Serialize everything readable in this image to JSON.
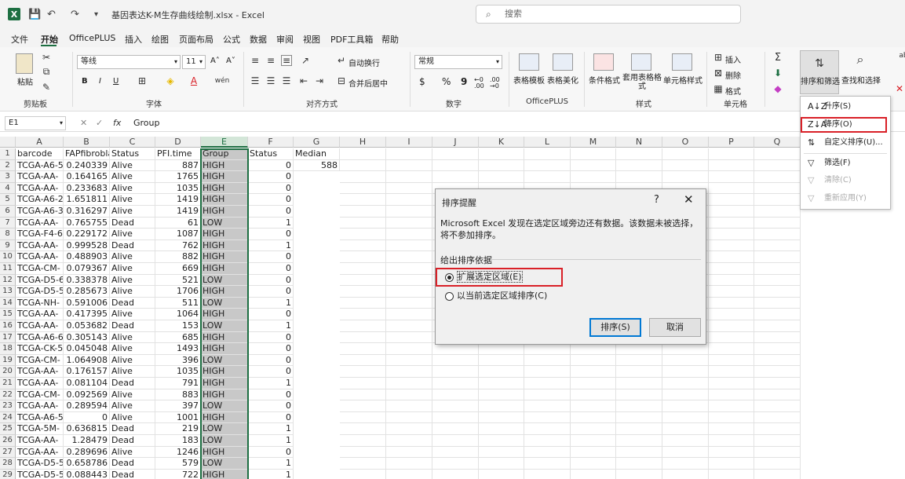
{
  "titlebar": {
    "save_glyph": "💾",
    "undo_glyph": "↶",
    "redo_glyph": "↷",
    "custom_glyph": "▾",
    "title": "基因表达K-M生存曲线绘制.xlsx  -  Excel",
    "search_placeholder": "搜索"
  },
  "menu": [
    "文件",
    "开始",
    "OfficePLUS",
    "插入",
    "绘图",
    "页面布局",
    "公式",
    "数据",
    "审阅",
    "视图",
    "PDF工具箱",
    "帮助"
  ],
  "ribbon": {
    "clipboard": {
      "label": "剪贴板",
      "paste": "粘贴"
    },
    "font": {
      "label": "字体",
      "name": "等线",
      "size": "11",
      "bold": "B",
      "italic": "I",
      "underline": "U",
      "grow": "A˄",
      "shrink": "A˅"
    },
    "align": {
      "label": "对齐方式",
      "wrap": "自动换行",
      "merge": "合并后居中"
    },
    "number": {
      "label": "数字",
      "format": "常规",
      "currency": "$",
      "percent": "%",
      "comma": "9",
      "inc": "←0 .00",
      "dec": ".00 →0"
    },
    "officeplus": {
      "label": "OfficePLUS",
      "table_template": "表格模板",
      "table_beautify": "表格美化"
    },
    "styles": {
      "label": "样式",
      "cond_format": "条件格式",
      "apply_table": "套用表格格式",
      "cell_styles": "单元格样式"
    },
    "cells": {
      "label": "单元格",
      "insert": "插入",
      "delete": "删除",
      "format": "格式"
    },
    "editing": {
      "sum": "Σ",
      "fill": "⬇",
      "clear": "◆",
      "sort_filter": "排序和筛选",
      "find_select": "查找和选择",
      "side1": "ab",
      "side2": "✕"
    }
  },
  "formula": {
    "namebox": "E1",
    "fx": "fx",
    "content": "Group"
  },
  "columns": [
    "A",
    "B",
    "C",
    "D",
    "E",
    "F",
    "G",
    "H",
    "I",
    "J",
    "K",
    "L",
    "M",
    "N",
    "O",
    "P",
    "Q"
  ],
  "headers": {
    "a": "barcode",
    "b": "FAPfibroblasts",
    "c": "Status",
    "d": "PFI.time",
    "e": "Group",
    "f": "Status",
    "g": "Median"
  },
  "g2": "588",
  "rows": [
    {
      "n": "2",
      "a": "TCGA-A6-5",
      "b": "0.240339",
      "c": "Alive",
      "d": "887",
      "e": "HIGH",
      "f": "0"
    },
    {
      "n": "3",
      "a": "TCGA-AA-",
      "b": "0.164165",
      "c": "Alive",
      "d": "1765",
      "e": "HIGH",
      "f": "0"
    },
    {
      "n": "4",
      "a": "TCGA-AA-",
      "b": "0.233683",
      "c": "Alive",
      "d": "1035",
      "e": "HIGH",
      "f": "0"
    },
    {
      "n": "5",
      "a": "TCGA-A6-2",
      "b": "1.651811",
      "c": "Alive",
      "d": "1419",
      "e": "HIGH",
      "f": "0"
    },
    {
      "n": "6",
      "a": "TCGA-A6-3",
      "b": "0.316297",
      "c": "Alive",
      "d": "1419",
      "e": "HIGH",
      "f": "0"
    },
    {
      "n": "7",
      "a": "TCGA-AA-",
      "b": "0.765755",
      "c": "Dead",
      "d": "61",
      "e": "LOW",
      "f": "1"
    },
    {
      "n": "8",
      "a": "TCGA-F4-6",
      "b": "0.229172",
      "c": "Alive",
      "d": "1087",
      "e": "HIGH",
      "f": "0"
    },
    {
      "n": "9",
      "a": "TCGA-AA-",
      "b": "0.999528",
      "c": "Dead",
      "d": "762",
      "e": "HIGH",
      "f": "1"
    },
    {
      "n": "10",
      "a": "TCGA-AA-",
      "b": "0.488903",
      "c": "Alive",
      "d": "882",
      "e": "HIGH",
      "f": "0"
    },
    {
      "n": "11",
      "a": "TCGA-CM-",
      "b": "0.079367",
      "c": "Alive",
      "d": "669",
      "e": "HIGH",
      "f": "0"
    },
    {
      "n": "12",
      "a": "TCGA-D5-6",
      "b": "0.338378",
      "c": "Alive",
      "d": "521",
      "e": "LOW",
      "f": "0"
    },
    {
      "n": "13",
      "a": "TCGA-D5-5",
      "b": "0.285673",
      "c": "Alive",
      "d": "1706",
      "e": "HIGH",
      "f": "0"
    },
    {
      "n": "14",
      "a": "TCGA-NH-",
      "b": "0.591006",
      "c": "Dead",
      "d": "511",
      "e": "LOW",
      "f": "1"
    },
    {
      "n": "15",
      "a": "TCGA-AA-",
      "b": "0.417395",
      "c": "Alive",
      "d": "1064",
      "e": "HIGH",
      "f": "0"
    },
    {
      "n": "16",
      "a": "TCGA-AA-",
      "b": "0.053682",
      "c": "Dead",
      "d": "153",
      "e": "LOW",
      "f": "1"
    },
    {
      "n": "17",
      "a": "TCGA-A6-6",
      "b": "0.305143",
      "c": "Alive",
      "d": "685",
      "e": "HIGH",
      "f": "0"
    },
    {
      "n": "18",
      "a": "TCGA-CK-5",
      "b": "0.045048",
      "c": "Alive",
      "d": "1493",
      "e": "HIGH",
      "f": "0"
    },
    {
      "n": "19",
      "a": "TCGA-CM-",
      "b": "1.064908",
      "c": "Alive",
      "d": "396",
      "e": "LOW",
      "f": "0"
    },
    {
      "n": "20",
      "a": "TCGA-AA-",
      "b": "0.176157",
      "c": "Alive",
      "d": "1035",
      "e": "HIGH",
      "f": "0"
    },
    {
      "n": "21",
      "a": "TCGA-AA-",
      "b": "0.081104",
      "c": "Dead",
      "d": "791",
      "e": "HIGH",
      "f": "1"
    },
    {
      "n": "22",
      "a": "TCGA-CM-",
      "b": "0.092569",
      "c": "Alive",
      "d": "883",
      "e": "HIGH",
      "f": "0"
    },
    {
      "n": "23",
      "a": "TCGA-AA-",
      "b": "0.289594",
      "c": "Alive",
      "d": "397",
      "e": "LOW",
      "f": "0"
    },
    {
      "n": "24",
      "a": "TCGA-A6-5",
      "b": "0",
      "c": "Alive",
      "d": "1001",
      "e": "HIGH",
      "f": "0"
    },
    {
      "n": "25",
      "a": "TCGA-5M-",
      "b": "0.636815",
      "c": "Dead",
      "d": "219",
      "e": "LOW",
      "f": "1"
    },
    {
      "n": "26",
      "a": "TCGA-AA-",
      "b": "1.28479",
      "c": "Dead",
      "d": "183",
      "e": "LOW",
      "f": "1"
    },
    {
      "n": "27",
      "a": "TCGA-AA-",
      "b": "0.289696",
      "c": "Alive",
      "d": "1246",
      "e": "HIGH",
      "f": "0"
    },
    {
      "n": "28",
      "a": "TCGA-D5-5",
      "b": "0.658786",
      "c": "Dead",
      "d": "579",
      "e": "LOW",
      "f": "1"
    },
    {
      "n": "29",
      "a": "TCGA-D5-5",
      "b": "0.088443",
      "c": "Dead",
      "d": "722",
      "e": "HIGH",
      "f": "1"
    }
  ],
  "dialog": {
    "title": "排序提醒",
    "help": "?",
    "close": "✕",
    "message": "Microsoft Excel 发现在选定区域旁边还有数据。该数据未被选择，将不参加排序。",
    "group": "给出排序依据",
    "opt1": "扩展选定区域(E)",
    "opt2": "以当前选定区域排序(C)",
    "ok": "排序(S)",
    "cancel": "取消"
  },
  "sortmenu": [
    {
      "icon": "A↓Z",
      "label": "升序(S)",
      "disabled": false
    },
    {
      "icon": "Z↓A",
      "label": "降序(O)",
      "disabled": false
    },
    {
      "icon": "⇅",
      "label": "自定义排序(U)...",
      "disabled": false
    },
    {
      "icon": "▽",
      "label": "筛选(F)",
      "disabled": false
    },
    {
      "icon": "▽",
      "label": "清除(C)",
      "disabled": true
    },
    {
      "icon": "▽",
      "label": "重新应用(Y)",
      "disabled": true
    }
  ],
  "colors": {
    "excel_green": "#1d6f42",
    "highlight_red": "#d92027",
    "selected_col": "#c8c8c8"
  }
}
